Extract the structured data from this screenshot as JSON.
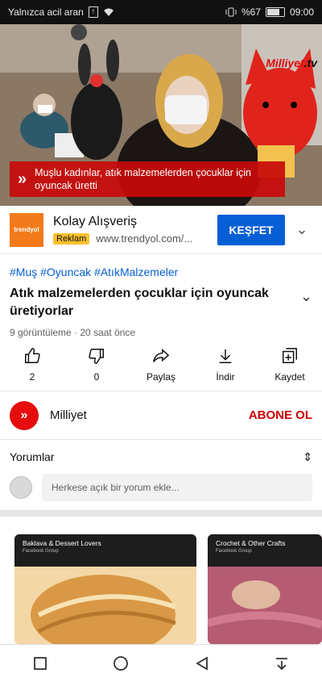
{
  "status_bar": {
    "carrier_text": "Yalnızca acil aran",
    "battery_percent": "%67",
    "battery_level": 0.67,
    "time": "09:00"
  },
  "video": {
    "brand_logo": "Milliyet",
    "brand_suffix": ".tv",
    "caption": "Muşlu kadınlar, atık malzemelerden çocuklar için oyuncak üretti"
  },
  "ad": {
    "logo_text": "trendyol",
    "title": "Kolay Alışveriş",
    "badge": "Reklam",
    "url": "www.trendyol.com/...",
    "button_label": "KEŞFET"
  },
  "video_meta": {
    "hashtags": "#Muş #Oyuncak #AtıkMalzemeler",
    "title": "Atık malzemelerden çocuklar için oyuncak üretiyorlar",
    "view_info": "9 görüntüleme · 20 saat önce"
  },
  "actions": [
    {
      "label": "2",
      "icon": "thumbs-up-icon"
    },
    {
      "label": "0",
      "icon": "thumbs-down-icon"
    },
    {
      "label": "Paylaş",
      "icon": "share-icon"
    },
    {
      "label": "İndir",
      "icon": "download-icon"
    },
    {
      "label": "Kaydet",
      "icon": "save-playlist-icon"
    }
  ],
  "channel": {
    "name": "Milliyet",
    "subscribe_label": "ABONE OL"
  },
  "comments": {
    "header": "Yorumlar",
    "placeholder": "Herkese açık bir yorum ekle..."
  },
  "cards": [
    {
      "title": "Baklava & Dessert Lovers",
      "subtitle": "Facebook Group"
    },
    {
      "title": "Crochet & Other Crafts",
      "subtitle": "Facebook Group"
    }
  ],
  "colors": {
    "accent_blue": "#065fd4",
    "subscribe_red": "#cc0000",
    "ad_badge": "#fbc02d"
  }
}
